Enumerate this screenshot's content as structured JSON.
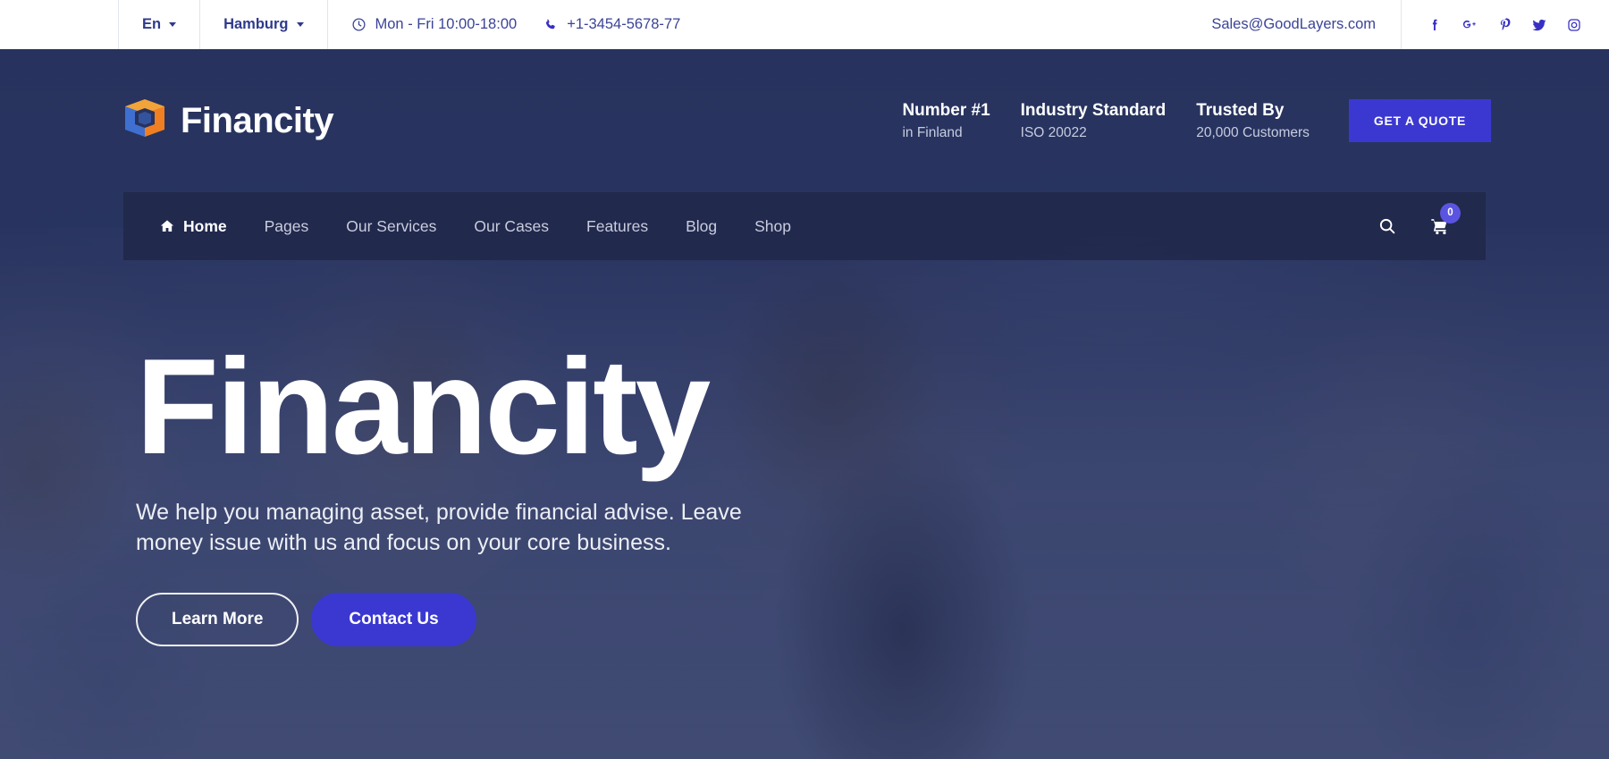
{
  "topbar": {
    "language": "En",
    "city": "Hamburg",
    "hours": "Mon - Fri 10:00-18:00",
    "phone": "+1-3454-5678-77",
    "email": "Sales@GoodLayers.com",
    "social": [
      {
        "name": "facebook-icon",
        "label": "f"
      },
      {
        "name": "google-plus-icon",
        "label": "G+"
      },
      {
        "name": "pinterest-icon",
        "label": "P"
      },
      {
        "name": "twitter-icon",
        "label": "t"
      },
      {
        "name": "instagram-icon",
        "label": "ig"
      }
    ],
    "icons": {
      "clock": "clock-icon",
      "phone": "phone-icon"
    }
  },
  "header": {
    "logo_text": "Financity",
    "stats": [
      {
        "title": "Number #1",
        "sub": "in Finland"
      },
      {
        "title": "Industry Standard",
        "sub": "ISO 20022"
      },
      {
        "title": "Trusted By",
        "sub": "20,000 Customers"
      }
    ],
    "quote_button": "GET A QUOTE"
  },
  "nav": {
    "items": [
      {
        "label": "Home",
        "active": true,
        "icon": "home-icon"
      },
      {
        "label": "Pages",
        "active": false
      },
      {
        "label": "Our Services",
        "active": false
      },
      {
        "label": "Our Cases",
        "active": false
      },
      {
        "label": "Features",
        "active": false
      },
      {
        "label": "Blog",
        "active": false
      },
      {
        "label": "Shop",
        "active": false
      }
    ],
    "cart_count": "0"
  },
  "hero": {
    "title": "Financity",
    "subtitle": "We help you managing asset, provide financial advise. Leave money issue with us and focus on your core business.",
    "primary_button": "Contact Us",
    "secondary_button": "Learn More"
  },
  "colors": {
    "accent": "#3b38d1",
    "top_bar_text": "#2e3a8c",
    "hero_overlay": "#243166",
    "nav_bg": "#20284a",
    "badge": "#5b54e0"
  }
}
